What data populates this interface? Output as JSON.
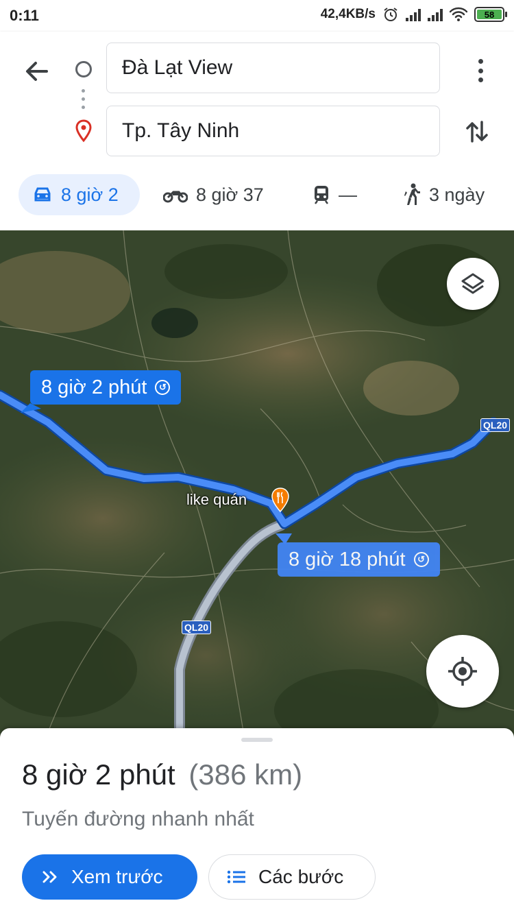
{
  "status_bar": {
    "time": "0:11",
    "network_speed": "42,4KB/s",
    "battery": "58"
  },
  "search": {
    "origin": "Đà Lạt View",
    "destination": "Tp. Tây Ninh"
  },
  "modes": [
    {
      "name": "car",
      "label": "8 giờ 2"
    },
    {
      "name": "motorbike",
      "label": "8 giờ 37"
    },
    {
      "name": "transit",
      "label": "—"
    },
    {
      "name": "walk",
      "label": "3 ngày"
    }
  ],
  "map": {
    "route_main_label": "8 giờ 2 phút",
    "route_alt_label": "8 giờ 18 phút",
    "road_label_1": "QL20",
    "road_label_2": "QL20",
    "poi_label": "like quán",
    "colors": {
      "route_main": "#1a73e8",
      "route_alt": "#a9b4c2"
    }
  },
  "summary": {
    "duration": "8 giờ 2 phút",
    "distance": "(386 km)",
    "subtitle": "Tuyến đường nhanh nhất"
  },
  "actions": {
    "preview_label": "Xem trước",
    "steps_label": "Các bước"
  }
}
